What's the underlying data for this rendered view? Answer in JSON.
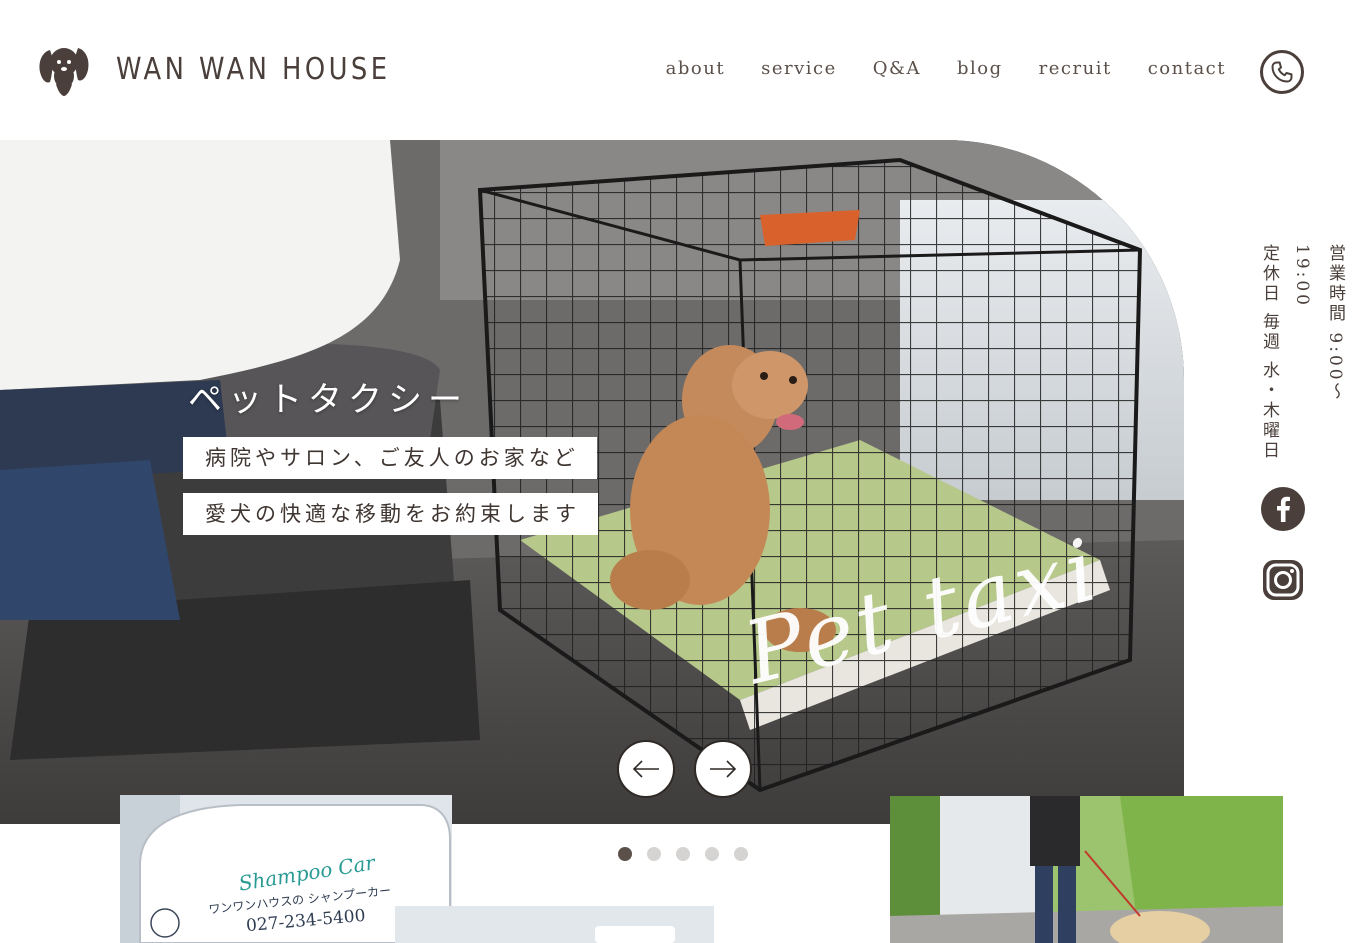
{
  "brand": {
    "name": "WAN WAN HOUSE"
  },
  "nav": {
    "items": [
      {
        "label": "about"
      },
      {
        "label": "service"
      },
      {
        "label": "Q&A"
      },
      {
        "label": "blog"
      },
      {
        "label": "recruit"
      },
      {
        "label": "contact"
      }
    ]
  },
  "hero": {
    "title": "ペットタクシー",
    "line1": "病院やサロン、ご友人のお家など",
    "line2": "愛犬の快適な移動をお約束します",
    "script": "Pet taxi",
    "prev_icon": "arrow-left-icon",
    "next_icon": "arrow-right-icon"
  },
  "side": {
    "hours": "営業時間 9:00～19:00",
    "holiday": "定休日 毎週 水・木曜日"
  },
  "social": {
    "facebook_icon": "facebook-icon",
    "instagram_icon": "instagram-icon"
  },
  "slider": {
    "total": 5,
    "active_index": 0
  },
  "thumbs": {
    "shampoo_car": {
      "title": "Shampoo Car",
      "subtitle": "ワンワンハウスの シャンプーカー",
      "phone": "027-234-5400"
    }
  },
  "colors": {
    "brand_brown": "#4a3f3a",
    "teal": "#2a9a95",
    "accent_orange": "#e07a3c"
  }
}
